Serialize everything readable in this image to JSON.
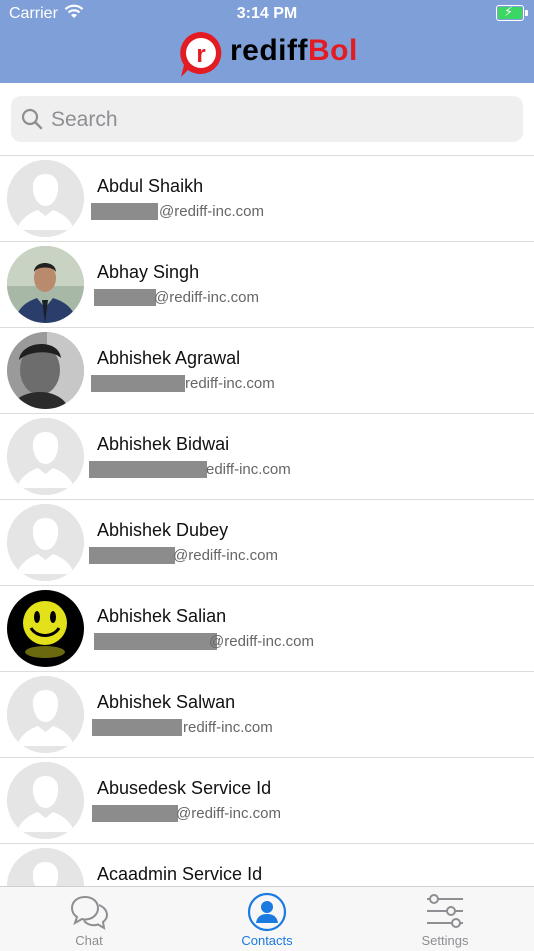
{
  "status_bar": {
    "carrier": "Carrier",
    "time": "3:14 PM"
  },
  "header": {
    "logo_text_1": "rediff",
    "logo_text_2": "Bol",
    "logo_mark": "r"
  },
  "search": {
    "placeholder": "Search"
  },
  "contacts": [
    {
      "name": "Abdul Shaikh",
      "email_visible": "@rediff-inc.com",
      "avatar": "placeholder"
    },
    {
      "name": "Abhay Singh",
      "email_visible": "@rediff-inc.com",
      "avatar": "photo"
    },
    {
      "name": "Abhishek Agrawal",
      "email_visible": "rediff-inc.com",
      "avatar": "photo"
    },
    {
      "name": "Abhishek Bidwai",
      "email_visible": "ediff-inc.com",
      "avatar": "placeholder"
    },
    {
      "name": "Abhishek Dubey",
      "email_visible": "@rediff-inc.com",
      "avatar": "placeholder"
    },
    {
      "name": "Abhishek Salian",
      "email_visible": "@rediff-inc.com",
      "avatar": "smiley"
    },
    {
      "name": "Abhishek Salwan",
      "email_visible": "rediff-inc.com",
      "avatar": "placeholder"
    },
    {
      "name": "Abusedesk Service Id",
      "email_visible": "@rediff-inc.com",
      "avatar": "placeholder"
    },
    {
      "name": "Acaadmin Service Id",
      "email_visible": "",
      "avatar": "placeholder"
    }
  ],
  "tabs": [
    {
      "label": "Chat",
      "icon": "chat-bubbles-icon",
      "active": false
    },
    {
      "label": "Contacts",
      "icon": "contacts-person-icon",
      "active": true
    },
    {
      "label": "Settings",
      "icon": "sliders-icon",
      "active": false
    }
  ],
  "colors": {
    "header_bg": "#7f9fd9",
    "active_tab": "#1a7ae0",
    "inactive_tab": "#8e8e93",
    "brand_red": "#e31b23"
  }
}
